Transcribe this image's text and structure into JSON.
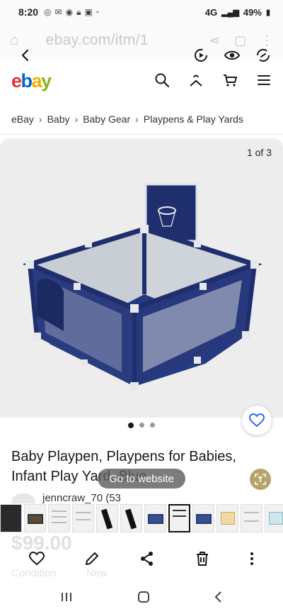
{
  "status_bar": {
    "time": "8:20",
    "network": "4G",
    "battery": "49%"
  },
  "browser": {
    "url": "ebay.com/itm/1"
  },
  "brand": {
    "logo_e": "e",
    "logo_b": "b",
    "logo_a": "a",
    "logo_y": "y"
  },
  "breadcrumb": [
    "eBay",
    "Baby",
    "Baby Gear",
    "Playpens & Play Yards"
  ],
  "gallery": {
    "counter": "1 of 3",
    "dots_total": 3,
    "dots_active": 1
  },
  "listing": {
    "title_line1": "Baby Playpen, Playpens for Babies,",
    "title_line2": "Infant Play Yard, Blue",
    "seller": "jenncraw_70 (53",
    "price": "$99.00",
    "condition_label": "Condition",
    "condition_value": "New"
  },
  "overlay": {
    "goto_website": "Go to website"
  },
  "colors": {
    "accent": "#0064d2",
    "playpen": "#1f2f6e",
    "ebay_red": "#e53238",
    "ebay_yellow": "#f5af02",
    "ebay_green": "#86b817"
  },
  "icons": {
    "overlay": [
      "back-icon",
      "screen-record-icon",
      "eye-icon",
      "sync-icon"
    ],
    "header": [
      "search-icon",
      "account-icon",
      "cart-icon",
      "menu-icon"
    ],
    "toolbar": [
      "heart-icon",
      "pen-icon",
      "share-icon",
      "trash-icon",
      "more-icon"
    ],
    "system": [
      "recents-icon",
      "home-icon",
      "back-nav-icon"
    ]
  }
}
